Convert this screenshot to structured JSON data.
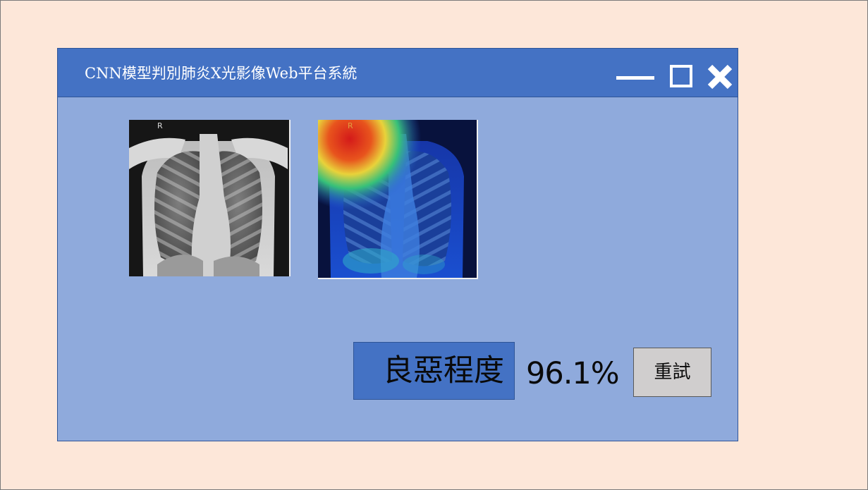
{
  "window": {
    "title": "CNN模型判別肺炎X光影像Web平台系統",
    "controls": {
      "minimize_icon": "minimize-icon",
      "maximize_icon": "maximize-icon",
      "close_icon": "close-icon"
    }
  },
  "images": {
    "original": {
      "marker": "R"
    },
    "heatmap": {
      "marker": "R"
    }
  },
  "result": {
    "label": "良惡程度",
    "value": "96.1%"
  },
  "retry_button": {
    "label": "重試"
  },
  "colors": {
    "background": "#FDE7D9",
    "window_body": "#8FAADC",
    "titlebar": "#4472C4",
    "label_box": "#4472C4",
    "button": "#D0CECE"
  }
}
